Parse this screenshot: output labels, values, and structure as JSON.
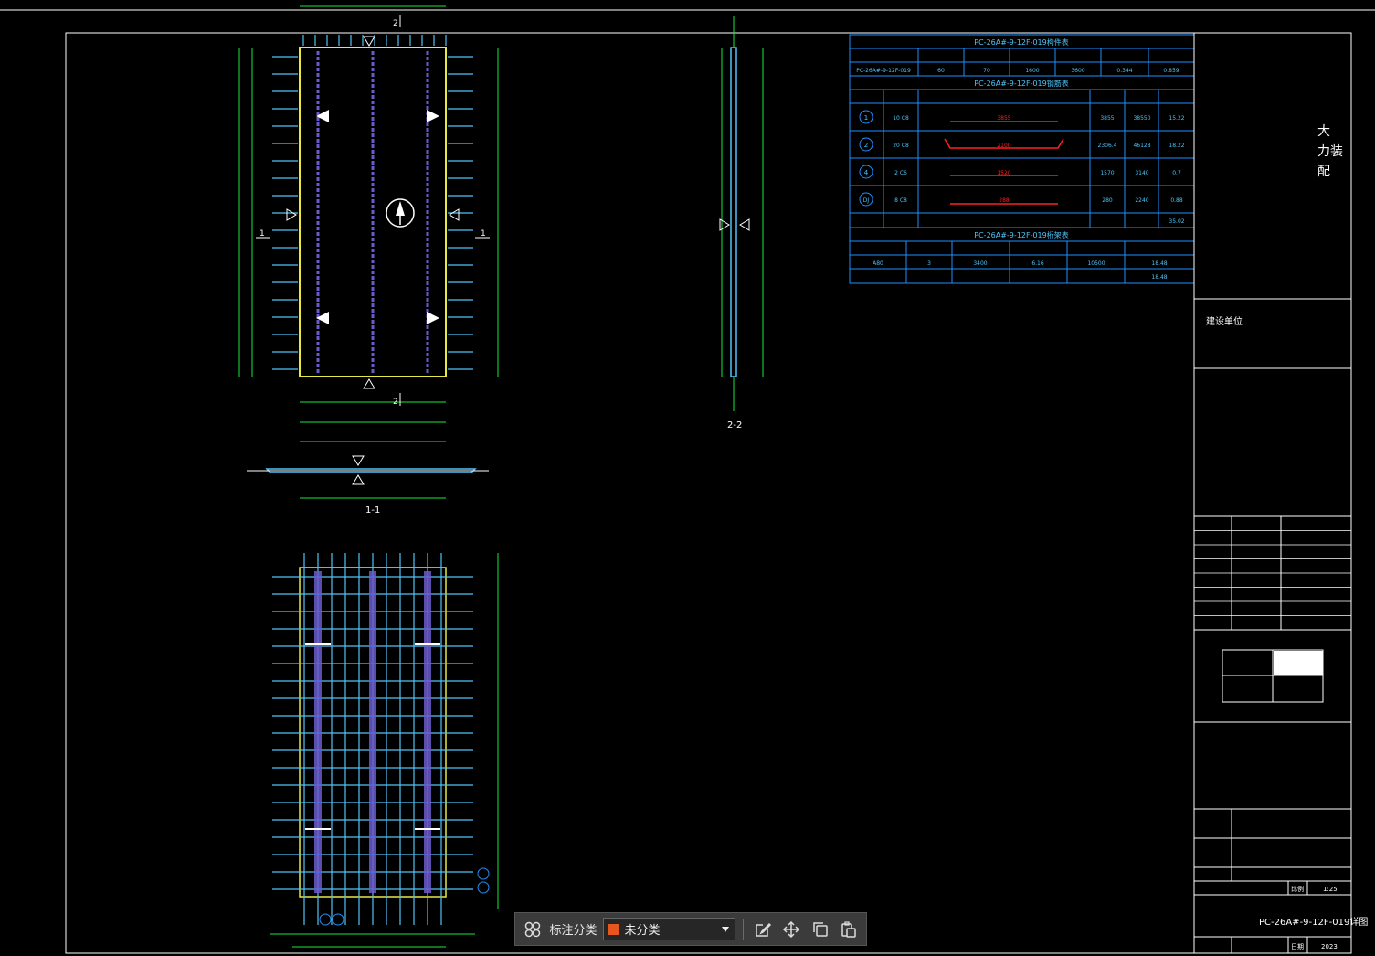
{
  "drawing": {
    "sheet_title_lines": [
      "大",
      "力装",
      "配"
    ],
    "construction_unit": "建设单位",
    "drawing_name": "PC-26A#-9-12F-019详图",
    "scale_label": "比例",
    "scale": "1:25",
    "date_label": "日期",
    "year": "2023",
    "section_1": "1-1",
    "section_2": "2-2",
    "marker_2": "2",
    "marker_1": "1"
  },
  "tables": {
    "parts_title": "PC-26A#-9-12F-019构件表",
    "parts_row": [
      "PC-26A#-9-12F-019",
      "60",
      "70",
      "1600",
      "3600",
      "0.344",
      "0.859"
    ],
    "rebar_title": "PC-26A#-9-12F-019钢筋表",
    "rebar_rows": [
      {
        "id": "1",
        "spec": "10 C8",
        "shape": "3855",
        "len": "3855",
        "total": "38550",
        "weight": "15.22"
      },
      {
        "id": "2",
        "spec": "20 C8",
        "shape": "2100",
        "len": "2306.4",
        "total": "46128",
        "weight": "18.22"
      },
      {
        "id": "4",
        "spec": "2 C6",
        "shape": "1520",
        "len": "1570",
        "total": "3140",
        "weight": "0.7"
      },
      {
        "id": "DJ",
        "spec": "8 C8",
        "shape": "288",
        "len": "280",
        "total": "2240",
        "weight": "0.88"
      }
    ],
    "rebar_total": "35.02",
    "truss_title": "PC-26A#-9-12F-019桁架表",
    "truss_row": [
      "A80",
      "3",
      "3400",
      "6.16",
      "10500",
      "18.48"
    ],
    "truss_total": "18.48"
  },
  "toolbar": {
    "label": "标注分类",
    "selected": "未分类",
    "swatch_color": "#e8561f"
  },
  "colors": {
    "dimension": "#16e838",
    "rebar": "#4fc3f7",
    "truss": "#6a5acd",
    "outline": "#e8e840",
    "table": "#1e90ff",
    "frame": "#ffffff",
    "annotation": "#ff2020"
  }
}
